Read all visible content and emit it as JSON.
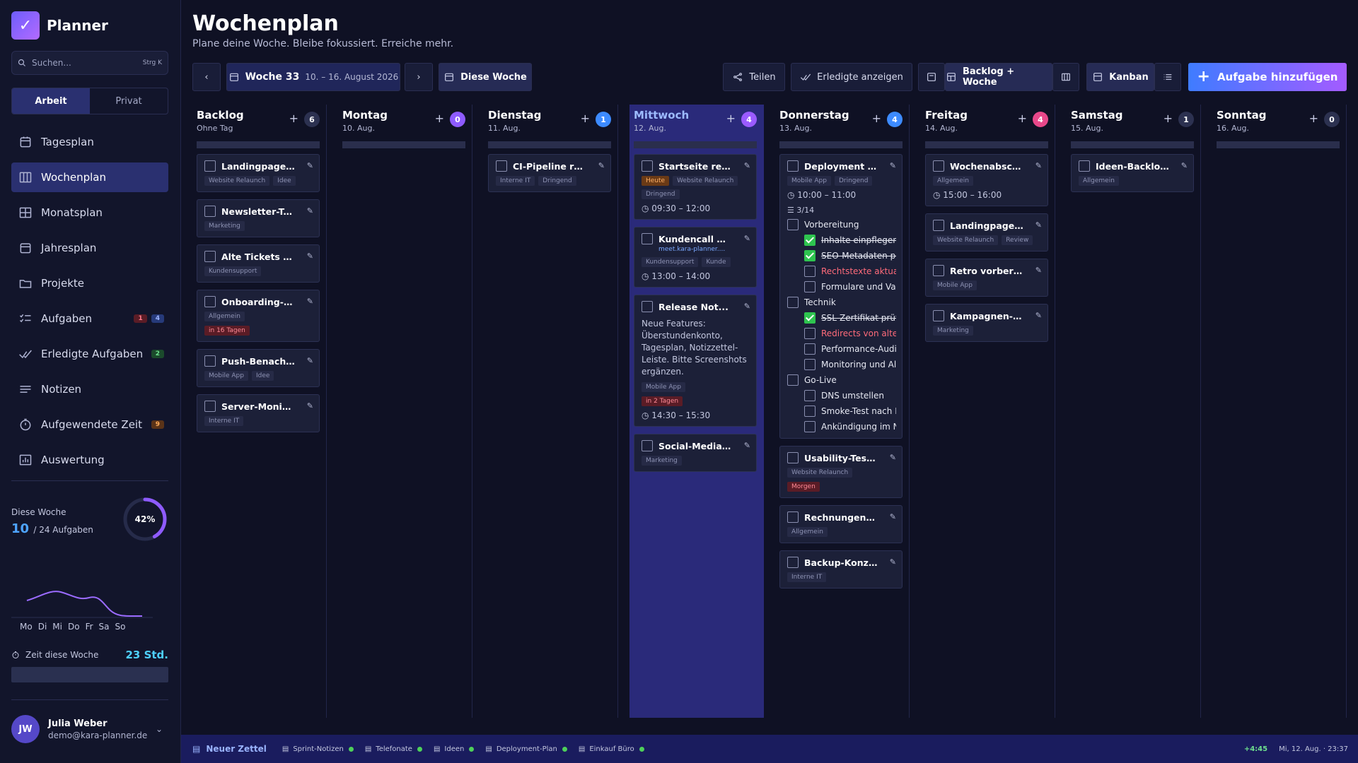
{
  "app": {
    "name": "Planner"
  },
  "search": {
    "placeholder": "Suchen...",
    "shortcut": "Strg K"
  },
  "modes": [
    "Arbeit",
    "Privat"
  ],
  "nav": [
    {
      "label": "Tagesplan",
      "icon": "calendar-day-icon"
    },
    {
      "label": "Wochenplan",
      "icon": "calendar-week-icon",
      "active": true
    },
    {
      "label": "Monatsplan",
      "icon": "grid-icon"
    },
    {
      "label": "Jahresplan",
      "icon": "calendar-icon"
    },
    {
      "label": "Projekte",
      "icon": "folder-icon"
    },
    {
      "label": "Aufgaben",
      "icon": "list-check-icon",
      "badges": [
        "1",
        "4"
      ]
    },
    {
      "label": "Erledigte Aufgaben",
      "icon": "double-check-icon",
      "badges": [
        "2"
      ]
    },
    {
      "label": "Notizen",
      "icon": "lines-icon"
    },
    {
      "label": "Aufgewendete Zeit",
      "icon": "stopwatch-icon",
      "badges": [
        "9"
      ]
    },
    {
      "label": "Auswertung",
      "icon": "chart-icon"
    }
  ],
  "stats": {
    "label": "Diese Woche",
    "done": "10",
    "total": "/ 24 Aufgaben",
    "percent": "42%",
    "percent_value": 42,
    "days": [
      "Mo",
      "Di",
      "Mi",
      "Do",
      "Fr",
      "Sa",
      "So"
    ],
    "time_label": "Zeit diese Woche",
    "time_value": "23 Std."
  },
  "user": {
    "initials": "JW",
    "name": "Julia Weber",
    "email": "demo@kara-planner.de"
  },
  "page": {
    "title": "Wochenplan",
    "subtitle": "Plane deine Woche. Bleibe fokussiert. Erreiche mehr."
  },
  "toolbar": {
    "week": "Woche 33",
    "range": "10. – 16. August 2026",
    "this_week": "Diese Woche",
    "share": "Teilen",
    "show_done": "Erledigte anzeigen",
    "backlog_week": "Backlog + Woche",
    "kanban": "Kanban",
    "add": "Aufgabe hinzufügen"
  },
  "columns": [
    {
      "name": "Backlog",
      "date": "Ohne Tag",
      "count": "6",
      "color": "#2c3150",
      "cards": [
        {
          "title": "Landingpage A/...",
          "tags": [
            "Website Relaunch",
            "Idee"
          ]
        },
        {
          "title": "Newsletter-Tool ...",
          "tags": [
            "Marketing"
          ]
        },
        {
          "title": "Alte Tickets arc...",
          "tags": [
            "Kundensupport"
          ]
        },
        {
          "title": "Onboarding-Dok...",
          "tags": [
            "Allgemein"
          ],
          "due": "in 16 Tagen"
        },
        {
          "title": "Push-Benachric...",
          "tags": [
            "Mobile App",
            "Idee"
          ]
        },
        {
          "title": "Server-Monitori...",
          "tags": [
            "Interne IT"
          ]
        }
      ]
    },
    {
      "name": "Montag",
      "date": "10. Aug.",
      "count": "0",
      "color": "#8e5bff",
      "cards": []
    },
    {
      "name": "Dienstag",
      "date": "11. Aug.",
      "count": "1",
      "color": "#3d8bff",
      "cards": [
        {
          "title": "CI-Pipeline repa...",
          "tags": [
            "Interne IT",
            "Dringend"
          ]
        }
      ]
    },
    {
      "name": "Mittwoch",
      "date": "12. Aug.",
      "count": "4",
      "color": "#9b5bff",
      "today": true,
      "cards": [
        {
          "title": "Startseite respo...",
          "tags": [
            "Website Relaunch"
          ],
          "due_today": "Heute",
          "tags2": [
            "Dringend"
          ],
          "time": "09:30 – 12:00"
        },
        {
          "title": "Kundencall Pfalz...",
          "link": "meet.kara-planner....",
          "tags": [
            "Kundensupport",
            "Kunde"
          ],
          "time": "13:00 – 14:00"
        },
        {
          "title": "Release Not...",
          "desc": "Neue Features: Überstundenkonto, Tagesplan, Notizzettel-Leiste. Bitte Screenshots ergänzen.",
          "tags": [
            "Mobile App"
          ],
          "due": "in 2 Tagen",
          "time": "14:30 – 15:30"
        },
        {
          "title": "Social-Media-Po...",
          "tags": [
            "Marketing"
          ]
        }
      ]
    },
    {
      "name": "Donnerstag",
      "date": "13. Aug.",
      "count": "4",
      "color": "#3d8bff",
      "cards": [
        {
          "title": "Deployment v2.4",
          "tags": [
            "Mobile App",
            "Dringend"
          ],
          "time": "10:00 – 11:00",
          "progress": "3/14",
          "subs": [
            {
              "t": "Vorbereitung",
              "lvl": 1
            },
            {
              "t": "Inhalte einpflegen",
              "lvl": 2,
              "done": true
            },
            {
              "t": "SEO-Metadaten prü",
              "lvl": 2,
              "done": true
            },
            {
              "t": "Rechtstexte aktualis",
              "lvl": 2,
              "red": true
            },
            {
              "t": "Formulare und Validi",
              "lvl": 2
            },
            {
              "t": "Technik",
              "lvl": 1
            },
            {
              "t": "SSL-Zertifikat prüfer",
              "lvl": 2,
              "done": true
            },
            {
              "t": "Redirects von alten U",
              "lvl": 2,
              "red": true
            },
            {
              "t": "Performance-Audit r",
              "lvl": 2
            },
            {
              "t": "Monitoring und Alert",
              "lvl": 2
            },
            {
              "t": "Go-Live",
              "lvl": 1
            },
            {
              "t": "DNS umstellen",
              "lvl": 2
            },
            {
              "t": "Smoke-Test nach De",
              "lvl": 2
            },
            {
              "t": "Ankündigung im Nev",
              "lvl": 2
            }
          ]
        },
        {
          "title": "Usability-Test d...",
          "tags": [
            "Website Relaunch"
          ],
          "due": "Morgen"
        },
        {
          "title": "Rechnungen prü...",
          "tags": [
            "Allgemein"
          ]
        },
        {
          "title": "Backup-Konzept...",
          "tags": [
            "Interne IT"
          ]
        }
      ]
    },
    {
      "name": "Freitag",
      "date": "14. Aug.",
      "count": "4",
      "color": "#e8488a",
      "cards": [
        {
          "title": "Wochenabschlu...",
          "tags": [
            "Allgemein"
          ],
          "time": "15:00 – 16:00"
        },
        {
          "title": "Landingpage-Te...",
          "tags": [
            "Website Relaunch",
            "Review"
          ]
        },
        {
          "title": "Retro vorbereiten",
          "tags": [
            "Mobile App"
          ]
        },
        {
          "title": "Kampagnen-Aus...",
          "tags": [
            "Marketing"
          ]
        }
      ]
    },
    {
      "name": "Samstag",
      "date": "15. Aug.",
      "count": "1",
      "color": "#2c3150",
      "cards": [
        {
          "title": "Ideen-Backlog a...",
          "tags": [
            "Allgemein"
          ]
        }
      ]
    },
    {
      "name": "Sonntag",
      "date": "16. Aug.",
      "count": "0",
      "color": "#2c3150",
      "cards": []
    }
  ],
  "footer": {
    "new_note": "Neuer Zettel",
    "notes": [
      "Sprint-Notizen",
      "Telefonate",
      "Ideen",
      "Deployment-Plan",
      "Einkauf Büro"
    ],
    "delta": "+4:45",
    "datetime": "Mi, 12. Aug. · 23:37"
  }
}
